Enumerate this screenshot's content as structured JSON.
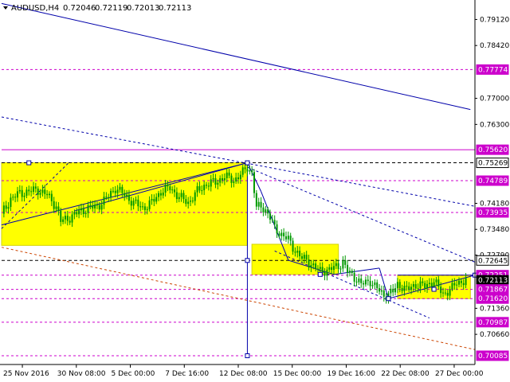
{
  "chart_data": {
    "type": "candlestick",
    "header": {
      "symbol_timeframe": "AUDUSD,H4",
      "ohlc": [
        "0.72046",
        "0.72119",
        "0.72013",
        "0.72113"
      ]
    },
    "ylim": [
      0.6985,
      0.796
    ],
    "price_ticks": [
      "0.79120",
      "0.78420",
      "0.77000",
      "0.76300",
      "0.74180",
      "0.73480",
      "0.72790",
      "0.71360",
      "0.70660"
    ],
    "level_labels": [
      {
        "text": "0.77774",
        "value": 0.77774,
        "style": "dash",
        "color": "#cc00cc"
      },
      {
        "text": "0.75620",
        "value": 0.7562,
        "style": "solid",
        "color": "#cc00cc"
      },
      {
        "text": "0.75269",
        "value": 0.75269,
        "style": "dash",
        "color": "#000000"
      },
      {
        "text": "0.74789",
        "value": 0.74789,
        "style": "dash",
        "color": "#cc00cc"
      },
      {
        "text": "0.73935",
        "value": 0.73935,
        "style": "dash",
        "color": "#cc00cc"
      },
      {
        "text": "0.72645",
        "value": 0.72645,
        "style": "dash",
        "color": "#000000"
      },
      {
        "text": "0.72251",
        "value": 0.72251,
        "style": "dash",
        "color": "#cc00cc"
      },
      {
        "text": "0.72113",
        "value": 0.72113,
        "style": "current",
        "color": "#000000"
      },
      {
        "text": "0.71867",
        "value": 0.71867,
        "style": "dash",
        "color": "#cc00cc"
      },
      {
        "text": "0.71620",
        "value": 0.7162,
        "style": "dash",
        "color": "#cc00cc"
      },
      {
        "text": "0.70987",
        "value": 0.70987,
        "style": "dash",
        "color": "#cc00cc"
      },
      {
        "text": "0.70085",
        "value": 0.70085,
        "style": "dash",
        "color": "#cc00cc"
      }
    ],
    "time_labels": [
      "25 Nov 2016",
      "30 Nov 08:00",
      "5 Dec 00:00",
      "7 Dec 16:00",
      "12 Dec 08:00",
      "15 Dec 00:00",
      "19 Dec 16:00",
      "22 Dec 08:00",
      "27 Dec 00:00"
    ],
    "zones": [
      {
        "from": 0,
        "to": 54,
        "high": 0.75269,
        "low": 0.7305
      },
      {
        "from": 55,
        "to": 74,
        "high": 0.7308,
        "low": 0.7227
      },
      {
        "from": 87,
        "to": 103,
        "high": 0.72251,
        "low": 0.7162
      }
    ],
    "close_path": [
      [
        0,
        0.739
      ],
      [
        2,
        0.743
      ],
      [
        4,
        0.7445
      ],
      [
        6,
        0.745
      ],
      [
        8,
        0.7455
      ],
      [
        10,
        0.744
      ],
      [
        12,
        0.741
      ],
      [
        13,
        0.737
      ],
      [
        15,
        0.738
      ],
      [
        17,
        0.7395
      ],
      [
        19,
        0.7405
      ],
      [
        21,
        0.741
      ],
      [
        23,
        0.743
      ],
      [
        25,
        0.746
      ],
      [
        27,
        0.744
      ],
      [
        29,
        0.742
      ],
      [
        31,
        0.7405
      ],
      [
        33,
        0.742
      ],
      [
        35,
        0.745
      ],
      [
        37,
        0.746
      ],
      [
        39,
        0.7435
      ],
      [
        41,
        0.742
      ],
      [
        43,
        0.745
      ],
      [
        45,
        0.747
      ],
      [
        47,
        0.7475
      ],
      [
        49,
        0.749
      ],
      [
        51,
        0.748
      ],
      [
        53,
        0.75
      ],
      [
        54,
        0.7515
      ],
      [
        55,
        0.75
      ],
      [
        56,
        0.7405
      ],
      [
        57,
        0.741
      ],
      [
        58,
        0.74
      ],
      [
        59,
        0.738
      ],
      [
        60,
        0.735
      ],
      [
        62,
        0.733
      ],
      [
        63,
        0.732
      ],
      [
        64,
        0.73
      ],
      [
        65,
        0.7285
      ],
      [
        66,
        0.727
      ],
      [
        67,
        0.7265
      ],
      [
        69,
        0.7245
      ],
      [
        70,
        0.7235
      ],
      [
        72,
        0.724
      ],
      [
        74,
        0.725
      ],
      [
        75,
        0.726
      ],
      [
        76,
        0.7235
      ],
      [
        78,
        0.7215
      ],
      [
        79,
        0.72
      ],
      [
        81,
        0.721
      ],
      [
        82,
        0.7195
      ],
      [
        84,
        0.717
      ],
      [
        86,
        0.718
      ],
      [
        87,
        0.72
      ],
      [
        88,
        0.7195
      ],
      [
        89,
        0.7185
      ],
      [
        91,
        0.72
      ],
      [
        93,
        0.7195
      ],
      [
        95,
        0.721
      ],
      [
        96,
        0.719
      ],
      [
        97,
        0.7175
      ],
      [
        99,
        0.719
      ],
      [
        100,
        0.7205
      ],
      [
        102,
        0.7211
      ]
    ],
    "trend_lines": [
      {
        "x1": 0,
        "v1": 0.7955,
        "x2": 103,
        "v2": 0.767,
        "color": "#0000aa",
        "dash": false
      },
      {
        "x1": 0,
        "v1": 0.736,
        "x2": 54,
        "v2": 0.75269,
        "color": "#0000aa",
        "dash": false
      },
      {
        "x1": 16,
        "v1": 0.73975,
        "x2": 54,
        "v2": 0.75269,
        "color": "#0000aa",
        "dash": false
      },
      {
        "x1": 54,
        "v1": 0.75269,
        "x2": 57,
        "v2": 0.745,
        "color": "#0000aa",
        "dash": false
      },
      {
        "x1": 57,
        "v1": 0.745,
        "x2": 63,
        "v2": 0.7265,
        "color": "#0000aa",
        "dash": false
      },
      {
        "x1": 63,
        "v1": 0.7265,
        "x2": 73,
        "v2": 0.7227,
        "color": "#0000aa",
        "dash": false
      },
      {
        "x1": 73,
        "v1": 0.7227,
        "x2": 83,
        "v2": 0.7244,
        "color": "#0000aa",
        "dash": false
      },
      {
        "x1": 83,
        "v1": 0.7244,
        "x2": 85,
        "v2": 0.7162,
        "color": "#0000aa",
        "dash": false
      },
      {
        "x1": 85,
        "v1": 0.7162,
        "x2": 104,
        "v2": 0.72251,
        "color": "#0000aa",
        "dash": false
      },
      {
        "x1": 87,
        "v1": 0.72251,
        "x2": 104,
        "v2": 0.72251,
        "color": "#0000aa",
        "dash": false
      },
      {
        "x1": 54,
        "v1": 0.75269,
        "x2": 54,
        "v2": 0.70085,
        "color": "#0000aa",
        "dash": false
      },
      {
        "x1": 0,
        "v1": 0.765,
        "x2": 104,
        "v2": 0.741,
        "color": "#0000aa",
        "dash": true
      },
      {
        "x1": 0,
        "v1": 0.735,
        "x2": 15,
        "v2": 0.753,
        "color": "#0000aa",
        "dash": true
      },
      {
        "x1": 54,
        "v1": 0.7515,
        "x2": 104,
        "v2": 0.726,
        "color": "#0000aa",
        "dash": true
      },
      {
        "x1": 60,
        "v1": 0.729,
        "x2": 94,
        "v2": 0.711,
        "color": "#0000aa",
        "dash": true
      },
      {
        "x1": 0,
        "v1": 0.73,
        "x2": 104,
        "v2": 0.7025,
        "color": "#cc4400",
        "dash": true
      }
    ],
    "markers": [
      {
        "x": 6,
        "v": 0.75269
      },
      {
        "x": 54,
        "v": 0.75269
      },
      {
        "x": 54,
        "v": 0.72645
      },
      {
        "x": 54,
        "v": 0.70085
      },
      {
        "x": 70,
        "v": 0.7227
      },
      {
        "x": 85,
        "v": 0.7162
      },
      {
        "x": 95,
        "v": 0.7187
      },
      {
        "x": 104,
        "v": 0.72251
      }
    ],
    "colors": {
      "background": "#ffffff",
      "zone": "#ffff00",
      "zone_border": "#d4d400",
      "candle": "#009900",
      "magenta": "#cc00cc",
      "trend": "#0000aa",
      "axis": "#000000"
    }
  }
}
